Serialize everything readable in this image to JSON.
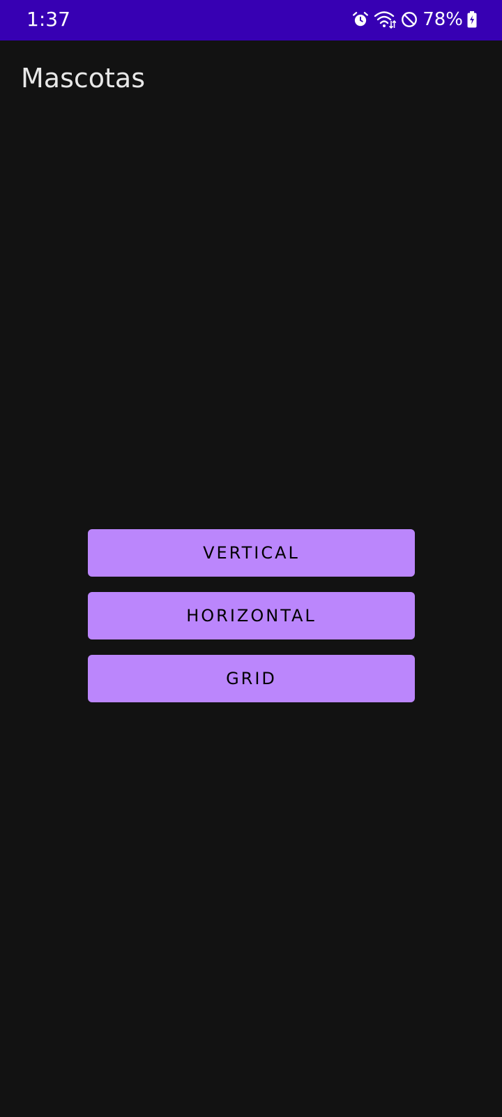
{
  "status_bar": {
    "time": "1:37",
    "battery": "78%",
    "icons": [
      "alarm-icon",
      "wifi-icon",
      "do-not-disturb-icon",
      "battery-charging-icon"
    ],
    "background_color": "#3700B3"
  },
  "app_bar": {
    "title": "Mascotas"
  },
  "buttons": {
    "vertical": "VERTICAL",
    "horizontal": "HORIZONTAL",
    "grid": "GRID",
    "color": "#BB86FC"
  },
  "theme": {
    "background": "#121212"
  }
}
